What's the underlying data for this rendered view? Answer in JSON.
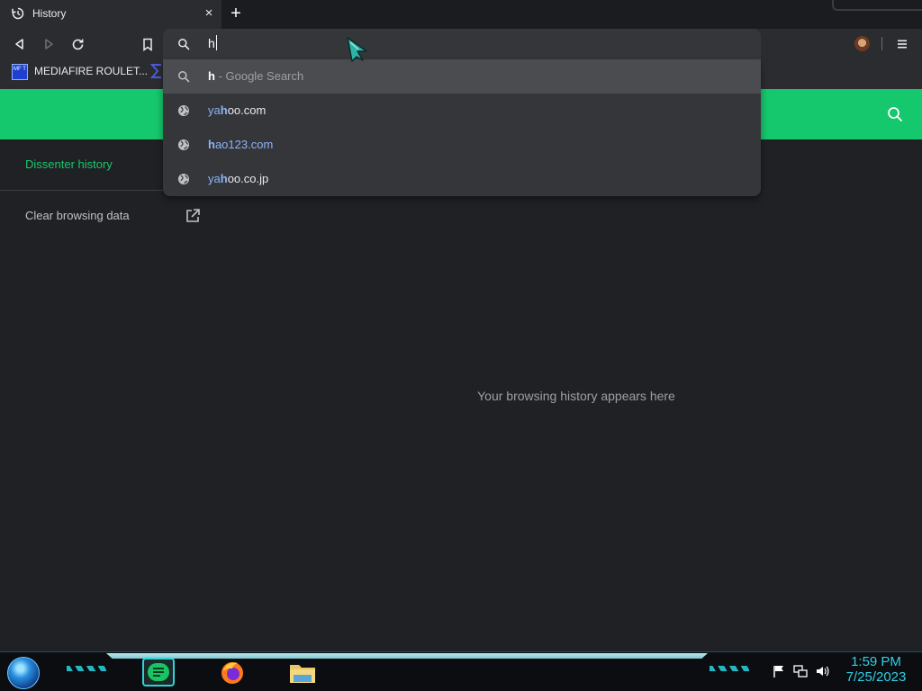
{
  "tab": {
    "title": "History",
    "close_glyph": "×",
    "new_tab_glyph": "+",
    "icon": "history-icon"
  },
  "toolbar": {
    "back_icon": "back-arrow-icon",
    "forward_icon": "forward-arrow-icon",
    "reload_icon": "reload-icon",
    "bookmark_icon": "bookmark-icon",
    "menu_icon": "menu-icon"
  },
  "omnibox": {
    "value": "h",
    "icon": "search-icon"
  },
  "bookmarks": [
    {
      "favicon_text": "MF T",
      "label": "MEDIAFIRE ROULET..."
    }
  ],
  "suggestions": [
    {
      "kind": "search",
      "match": "h",
      "desc": " - Google Search",
      "selected": true
    },
    {
      "kind": "url",
      "pre": "ya",
      "match": "h",
      "rest": "oo.com"
    },
    {
      "kind": "url",
      "pre": "",
      "match": "h",
      "rest": "ao123.com"
    },
    {
      "kind": "url",
      "pre": "ya",
      "match": "h",
      "rest": "oo.co.jp"
    }
  ],
  "sidebar": {
    "active_item": "Dissenter history",
    "clear_item": "Clear browsing data"
  },
  "main": {
    "empty_message": "Your browsing history appears here"
  },
  "taskbar": {
    "time": "1:59 PM",
    "date": "7/25/2023",
    "apps": [
      "notes-app-icon",
      "firefox-icon",
      "file-explorer-icon"
    ]
  },
  "colors": {
    "accent": "#15c76d",
    "link": "#8ab4f8",
    "clock": "#30d0e6"
  }
}
